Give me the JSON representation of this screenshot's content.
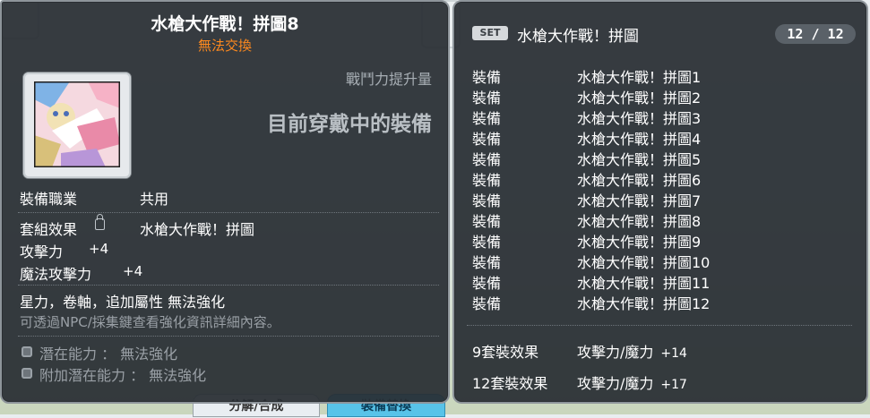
{
  "item": {
    "name": "水槍大作戰！拼圖8",
    "trade_status": "無法交換",
    "combat_power_label": "戰鬥力提升量",
    "equipped_notice": "目前穿戴中的裝備",
    "job_label": "裝備職業",
    "job_value": "共用",
    "set_effect_label": "套組效果",
    "set_effect_value": "水槍大作戰！拼圖",
    "stats": [
      {
        "label": "攻擊力",
        "value": "+4"
      },
      {
        "label": "魔法攻擊力",
        "value": "+4"
      }
    ],
    "enhance_note": "星力，卷軸，追加屬性 無法強化",
    "enhance_hint": "可透過NPC/採集鍵查看強化資訊詳細內容。",
    "potential": "潛在能力 ： 無法強化",
    "additional_potential": "附加潛在能力 ： 無法強化"
  },
  "set": {
    "badge": "SET",
    "name": "水槍大作戰！拼圖",
    "count": "12 / 12",
    "items": [
      {
        "type": "裝備",
        "name": "水槍大作戰！拼圖1"
      },
      {
        "type": "裝備",
        "name": "水槍大作戰！拼圖2"
      },
      {
        "type": "裝備",
        "name": "水槍大作戰！拼圖3"
      },
      {
        "type": "裝備",
        "name": "水槍大作戰！拼圖4"
      },
      {
        "type": "裝備",
        "name": "水槍大作戰！拼圖5"
      },
      {
        "type": "裝備",
        "name": "水槍大作戰！拼圖6"
      },
      {
        "type": "裝備",
        "name": "水槍大作戰！拼圖7"
      },
      {
        "type": "裝備",
        "name": "水槍大作戰！拼圖8"
      },
      {
        "type": "裝備",
        "name": "水槍大作戰！拼圖9"
      },
      {
        "type": "裝備",
        "name": "水槍大作戰！拼圖10"
      },
      {
        "type": "裝備",
        "name": "水槍大作戰！拼圖11"
      },
      {
        "type": "裝備",
        "name": "水槍大作戰！拼圖12"
      }
    ],
    "bonuses": [
      {
        "label": "9套裝效果",
        "stat": "攻擊力/魔力",
        "value": "+14"
      },
      {
        "label": "12套裝效果",
        "stat": "攻擊力/魔力",
        "value": "+17"
      }
    ]
  },
  "background": {
    "left_button": "分解/合成",
    "right_button": "裝備替換"
  },
  "colors": {
    "panel_bg": "#2b3035",
    "trade_status": "#ff8a1e",
    "muted_text": "#9aa0a6"
  }
}
